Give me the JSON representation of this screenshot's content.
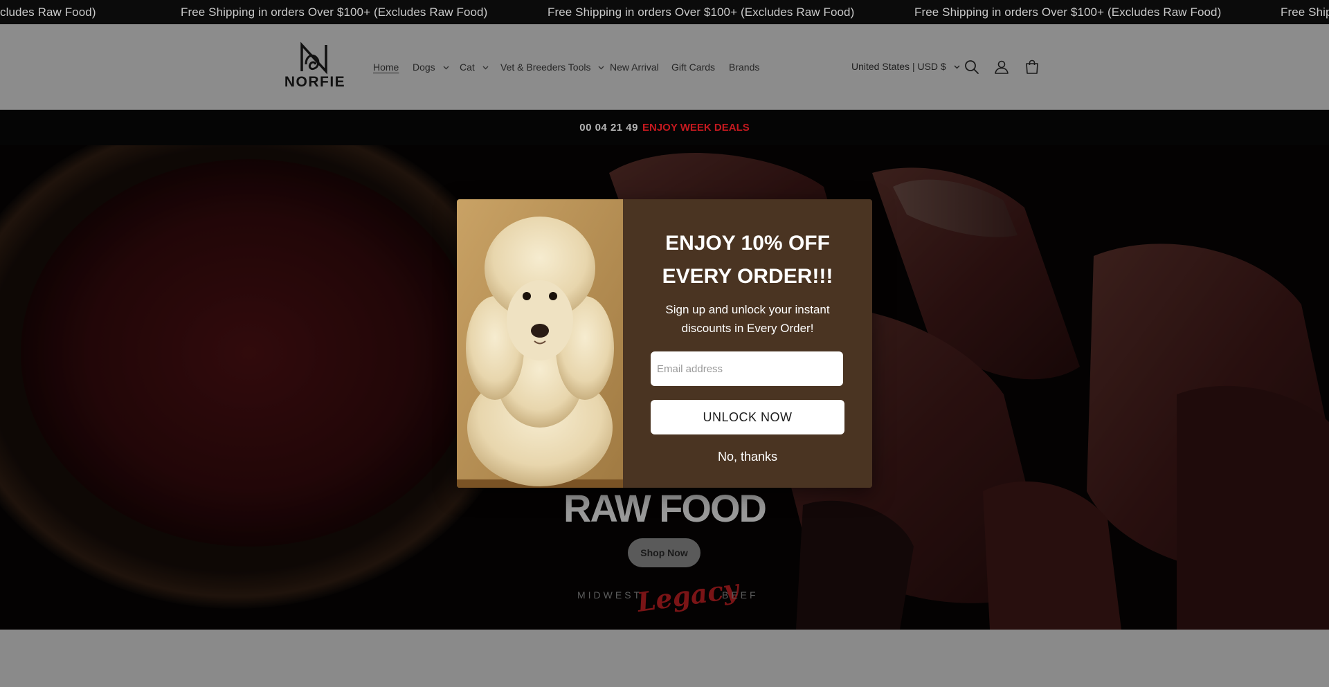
{
  "announcement": {
    "text": "Free Shipping in orders Over $100+ (Excludes Raw Food)",
    "partial_left": "cludes Raw Food)",
    "partial_right": "Free Shipping"
  },
  "header": {
    "logo_text": "NORFIE",
    "nav": [
      {
        "label": "Home",
        "active": true,
        "dropdown": false
      },
      {
        "label": "Dogs",
        "active": false,
        "dropdown": true
      },
      {
        "label": "Cat",
        "active": false,
        "dropdown": true
      },
      {
        "label": "Vet & Breeders Tools",
        "active": false,
        "dropdown": true
      },
      {
        "label": "New Arrival",
        "active": false,
        "dropdown": false
      },
      {
        "label": "Gift Cards",
        "active": false,
        "dropdown": false
      },
      {
        "label": "Brands",
        "active": false,
        "dropdown": false
      }
    ],
    "currency": "United States | USD $",
    "icons": [
      "search-icon",
      "account-icon",
      "cart-icon"
    ]
  },
  "deal_bar": {
    "timer": "00 04 21 49",
    "text": "ENJOY WEEK DEALS",
    "accent": "#c4191f"
  },
  "hero": {
    "title": "RAW FOOD",
    "cta": "Shop Now",
    "brand_left": "MIDWEST",
    "brand_script": "Legacy",
    "brand_right": "BEEF"
  },
  "popup": {
    "title_line1": "ENJOY 10% OFF",
    "title_line2": "EVERY ORDER!!!",
    "subtitle_line1": "Sign up and unlock your instant",
    "subtitle_line2": "discounts in Every Order!",
    "email_placeholder": "Email address",
    "email_value": "",
    "unlock_label": "UNLOCK NOW",
    "decline_label": "No, thanks",
    "background": "#4a3422"
  }
}
